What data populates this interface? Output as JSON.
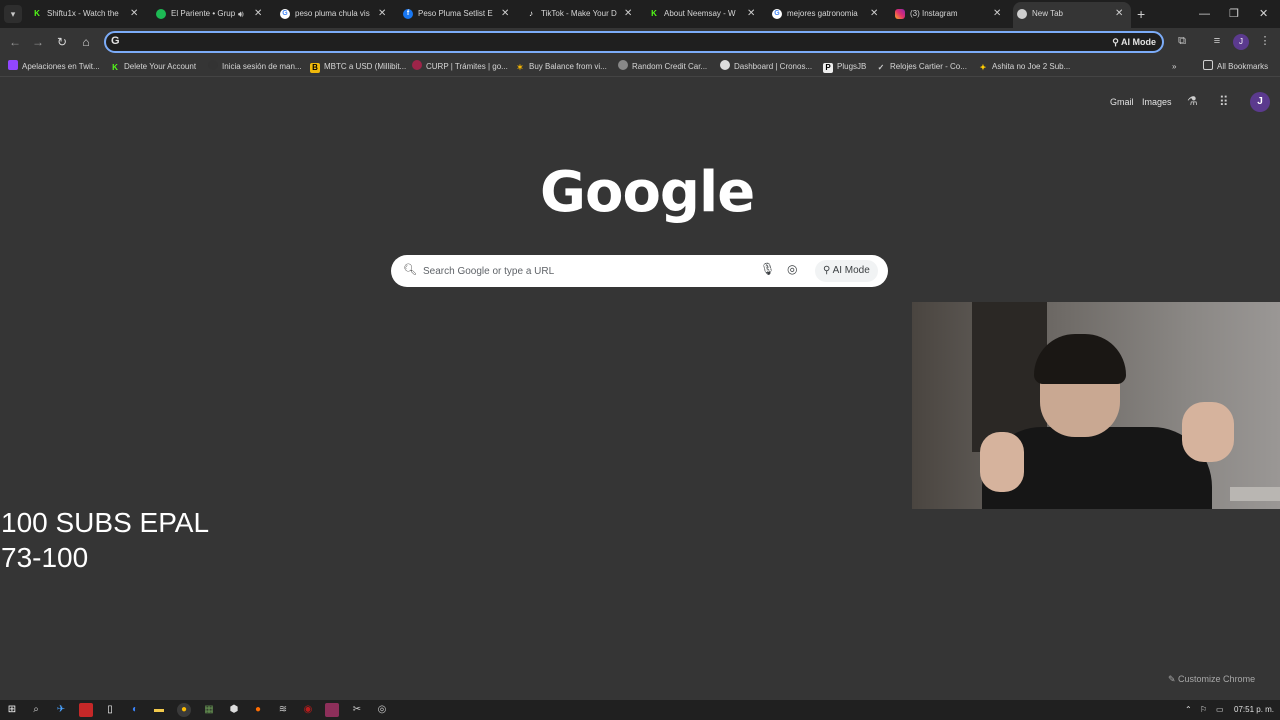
{
  "tabs": [
    {
      "title": "Shiftu1x - Watch the",
      "icon": "kick-icon",
      "color": "#53fc18"
    },
    {
      "title": "El Pariente • Grup",
      "icon": "spotify-icon",
      "color": "#1db954"
    },
    {
      "title": "peso pluma chula vis",
      "icon": "google-icon",
      "color": "#ffffff"
    },
    {
      "title": "Peso Pluma Setlist E",
      "icon": "facebook-icon",
      "color": "#1877f2"
    },
    {
      "title": "TikTok - Make Your D",
      "icon": "tiktok-icon",
      "color": "#ffffff"
    },
    {
      "title": "About Neemsay - W",
      "icon": "kick-icon",
      "color": "#53fc18"
    },
    {
      "title": "mejores gatronomia",
      "icon": "google-icon",
      "color": "#ffffff"
    },
    {
      "title": "(3) Instagram",
      "icon": "instagram-icon",
      "color": "#e1306c"
    },
    {
      "title": "New Tab",
      "icon": "chrome-icon",
      "color": "#ffffff"
    }
  ],
  "omnibox": {
    "value": "",
    "ai_mode": "AI Mode"
  },
  "bookmarks": [
    {
      "label": "Apelaciones en Twit...",
      "color": "#9146ff"
    },
    {
      "label": "Delete Your Account",
      "color": "#53fc18"
    },
    {
      "label": "Inicia sesión de man...",
      "color": "#333333"
    },
    {
      "label": "MBTC a USD (Millibit...",
      "color": "#f0b90b"
    },
    {
      "label": "CURP | Trámites | go...",
      "color": "#9d2449"
    },
    {
      "label": "Buy Balance from vi...",
      "color": "#f4b400"
    },
    {
      "label": "Random Credit Car...",
      "color": "#888888"
    },
    {
      "label": "Dashboard | Cronos...",
      "color": "#dddddd"
    },
    {
      "label": "PlugsJB",
      "color": "#eeeeee"
    },
    {
      "label": "Relojes Cartier - Co...",
      "color": "#cccccc"
    },
    {
      "label": "Ashita no Joe 2 Sub...",
      "color": "#ffcc00"
    }
  ],
  "all_bookmarks": "All Bookmarks",
  "top_links": {
    "gmail": "Gmail",
    "images": "Images",
    "profile_initial": "J"
  },
  "logo_text": "Google",
  "search": {
    "placeholder": "Search Google or type a URL",
    "ai_mode": "AI Mode"
  },
  "overlay": {
    "line1": "100 SUBS EPAL",
    "line2": "73-100"
  },
  "customize": "Customize Chrome",
  "taskbar": {
    "time": "07:51 p. m."
  }
}
